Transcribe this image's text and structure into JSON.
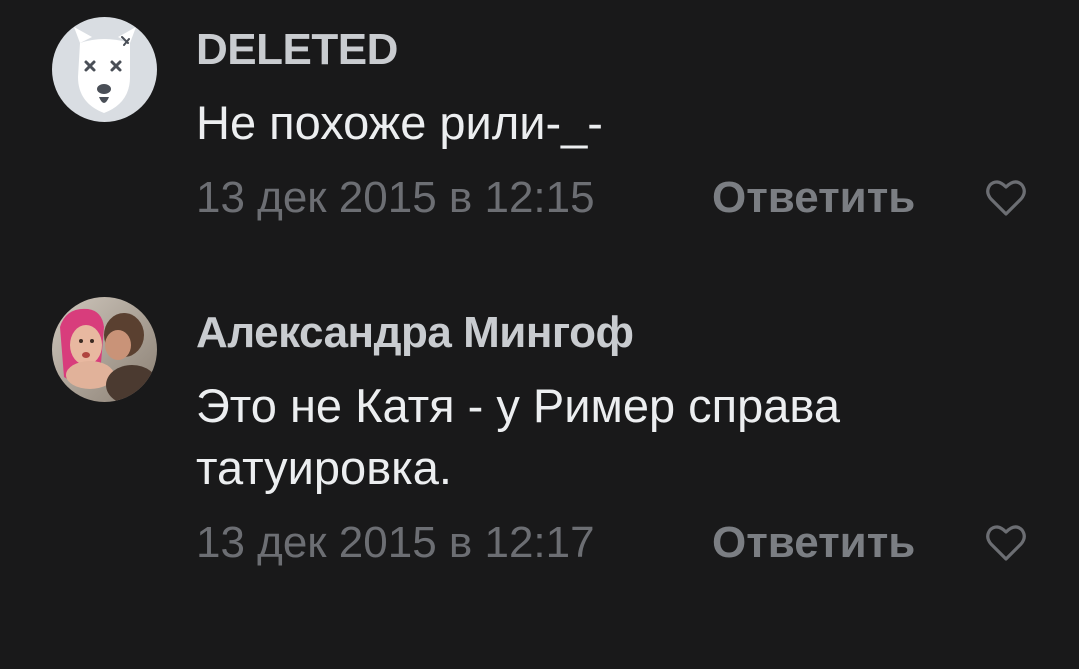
{
  "comments": [
    {
      "author": "DELETED",
      "text": "Не похоже рили-_-",
      "date": "13 дек 2015 в 12:15",
      "reply_label": "Ответить",
      "avatar": "deleted-dog-avatar",
      "like_icon": "heart-outline-icon"
    },
    {
      "author": "Александра Мингоф",
      "text": "Это не Катя - у Ример справа татуировка.",
      "date": "13 дек 2015 в 12:17",
      "reply_label": "Ответить",
      "avatar": "user-photo-avatar",
      "like_icon": "heart-outline-icon"
    }
  ],
  "colors": {
    "background": "#19191a",
    "author": "#c9ccd0",
    "text": "#eceef0",
    "meta": "#6c6e73"
  }
}
